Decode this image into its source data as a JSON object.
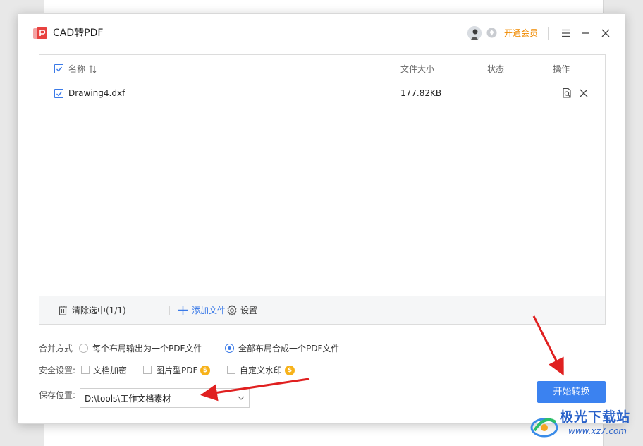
{
  "app": {
    "title": "CAD转PDF",
    "vip_label": "开通会员"
  },
  "table": {
    "headers": {
      "name": "名称",
      "size": "文件大小",
      "status": "状态",
      "action": "操作"
    },
    "rows": [
      {
        "name": "Drawing4.dxf",
        "size": "177.82KB",
        "status": ""
      }
    ]
  },
  "footer": {
    "clear_label": "清除选中(1/1)",
    "add_label": "添加文件",
    "settings_label": "设置"
  },
  "merge": {
    "label": "合并方式",
    "option1": "每个布局输出为一个PDF文件",
    "option2": "全部布局合成一个PDF文件",
    "selected": "option2"
  },
  "security": {
    "label": "安全设置:",
    "encrypt": "文档加密",
    "image_pdf": "图片型PDF",
    "watermark": "自定义水印"
  },
  "save": {
    "label": "保存位置:",
    "path": "D:\\tools\\工作文档素材"
  },
  "start_button": "开始转换",
  "site_watermark": {
    "title": "极光下载站",
    "url": "www.xz7.com"
  },
  "colors": {
    "accent": "#3b82f0",
    "vip": "#f08a00",
    "arrow": "#e02020"
  }
}
